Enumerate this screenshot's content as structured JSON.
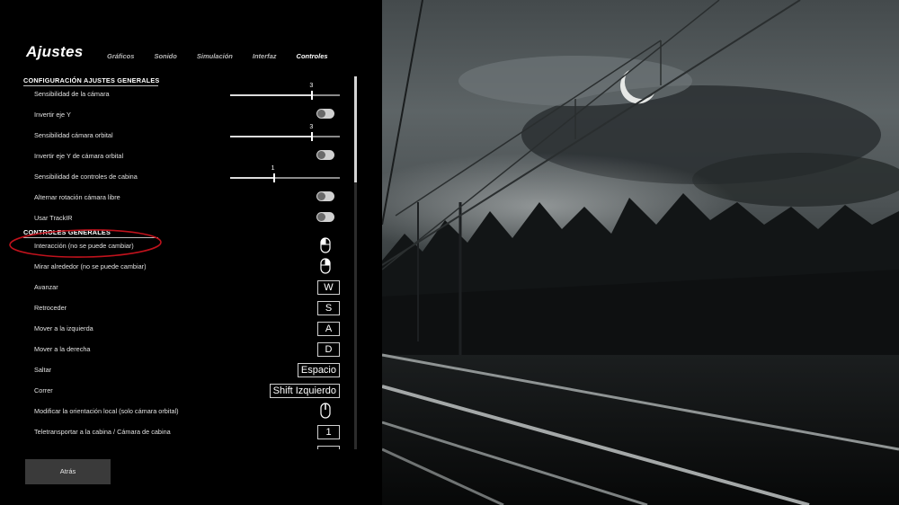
{
  "header": {
    "title": "Ajustes",
    "tabs": [
      {
        "label": "Gráficos",
        "active": false
      },
      {
        "label": "Sonido",
        "active": false
      },
      {
        "label": "Simulación",
        "active": false
      },
      {
        "label": "Interfaz",
        "active": false
      },
      {
        "label": "Controles",
        "active": true
      }
    ]
  },
  "sections": {
    "general_settings": "CONFIGURACIÓN AJUSTES GENERALES",
    "general_controls": "CONTROLES GENERALES"
  },
  "settings": [
    {
      "label": "Sensibilidad de la cámara",
      "type": "slider",
      "value": "3",
      "fraction": 0.74
    },
    {
      "label": "Invertir eje Y",
      "type": "toggle",
      "on": false
    },
    {
      "label": "Sensibilidad cámara orbital",
      "type": "slider",
      "value": "3",
      "fraction": 0.74
    },
    {
      "label": "Invertir eje Y de cámara orbital",
      "type": "toggle",
      "on": false
    },
    {
      "label": "Sensibilidad de controles de cabina",
      "type": "slider",
      "value": "1",
      "fraction": 0.39
    },
    {
      "label": "Alternar rotación cámara libre",
      "type": "toggle",
      "on": false
    },
    {
      "label": "Usar TrackIR",
      "type": "toggle",
      "on": false
    }
  ],
  "controls": [
    {
      "label": "Interacción (no se puede cambiar)",
      "binding_type": "mouse",
      "mouse_button": "left"
    },
    {
      "label": "Mirar alrededor (no se puede cambiar)",
      "binding_type": "mouse",
      "mouse_button": "right"
    },
    {
      "label": "Avanzar",
      "binding_type": "key",
      "key": "W"
    },
    {
      "label": "Retroceder",
      "binding_type": "key",
      "key": "S"
    },
    {
      "label": "Mover a la izquierda",
      "binding_type": "key",
      "key": "A"
    },
    {
      "label": "Mover a la derecha",
      "binding_type": "key",
      "key": "D"
    },
    {
      "label": "Saltar",
      "binding_type": "key",
      "key": "Espacio"
    },
    {
      "label": "Correr",
      "binding_type": "key",
      "key": "Shift Izquierdo"
    },
    {
      "label": "Modificar la orientación local (solo cámara orbital)",
      "binding_type": "mouse",
      "mouse_button": "middle"
    },
    {
      "label": "Teletransportar a la cabina / Cámara de cabina",
      "binding_type": "key",
      "key": "1"
    }
  ],
  "footer": {
    "back_label": "Atrás"
  },
  "colors": {
    "panel_bg": "#000000",
    "annotation": "#c0121c",
    "button_bg": "#3a3a3a"
  }
}
